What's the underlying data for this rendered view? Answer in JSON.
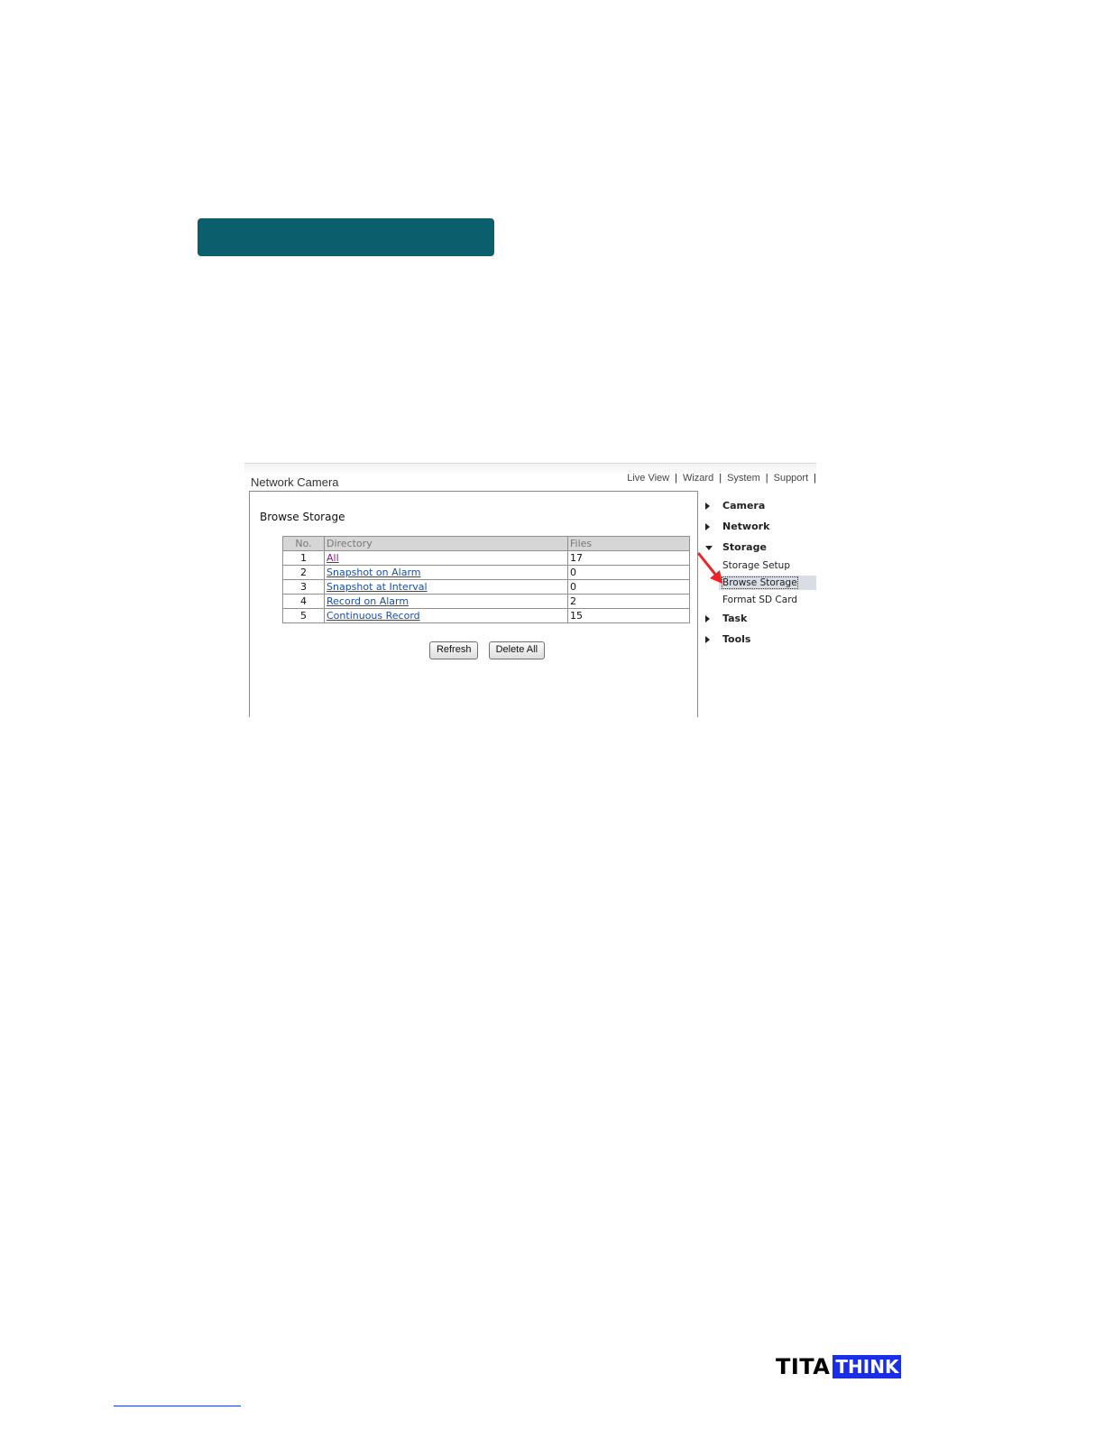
{
  "app": {
    "title": "Network Camera",
    "nav": [
      "Live View",
      "Wizard",
      "System",
      "Support"
    ],
    "nav_separator": "|"
  },
  "panel": {
    "heading": "Browse Storage",
    "table": {
      "columns": [
        "No.",
        "Directory",
        "Files"
      ],
      "rows": [
        {
          "no": "1",
          "directory": "All",
          "files": "17"
        },
        {
          "no": "2",
          "directory": "Snapshot on Alarm",
          "files": "0"
        },
        {
          "no": "3",
          "directory": "Snapshot at Interval",
          "files": "0"
        },
        {
          "no": "4",
          "directory": "Record on Alarm",
          "files": "2"
        },
        {
          "no": "5",
          "directory": "Continuous Record",
          "files": "15"
        }
      ]
    },
    "buttons": {
      "refresh": "Refresh",
      "delete_all": "Delete All"
    }
  },
  "side_menu": {
    "items": [
      "Camera",
      "Network",
      "Storage",
      "Task",
      "Tools"
    ],
    "storage_sub": [
      "Storage Setup",
      "Browse Storage",
      "Format SD Card"
    ],
    "active_sub": "Browse Storage"
  },
  "brand": {
    "part1": "TITA",
    "part2": "THINK",
    "accent": "#1a2ee6"
  },
  "colors": {
    "banner": "#0b5e6b",
    "annotation_arrow": "#e8262a"
  }
}
